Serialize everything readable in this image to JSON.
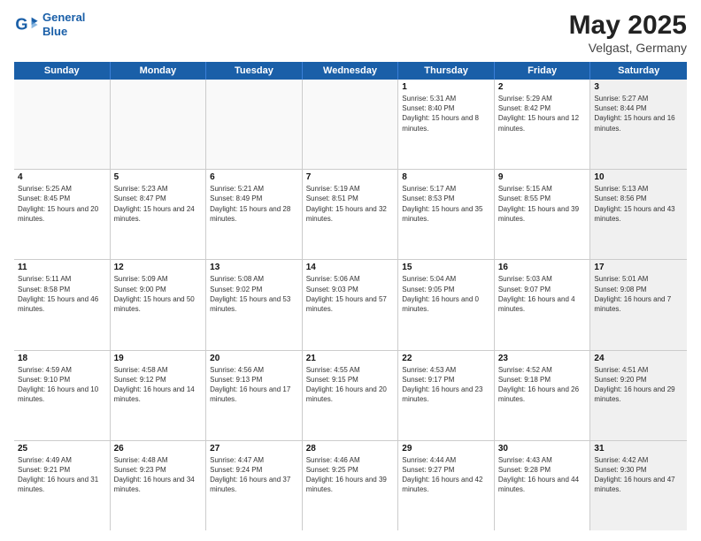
{
  "header": {
    "logo_line1": "General",
    "logo_line2": "Blue",
    "title": "May 2025",
    "subtitle": "Velgast, Germany"
  },
  "days_of_week": [
    "Sunday",
    "Monday",
    "Tuesday",
    "Wednesday",
    "Thursday",
    "Friday",
    "Saturday"
  ],
  "weeks": [
    [
      {
        "day": "",
        "sunrise": "",
        "sunset": "",
        "daylight": "",
        "shaded": false,
        "empty": true
      },
      {
        "day": "",
        "sunrise": "",
        "sunset": "",
        "daylight": "",
        "shaded": false,
        "empty": true
      },
      {
        "day": "",
        "sunrise": "",
        "sunset": "",
        "daylight": "",
        "shaded": false,
        "empty": true
      },
      {
        "day": "",
        "sunrise": "",
        "sunset": "",
        "daylight": "",
        "shaded": false,
        "empty": true
      },
      {
        "day": "1",
        "sunrise": "Sunrise: 5:31 AM",
        "sunset": "Sunset: 8:40 PM",
        "daylight": "Daylight: 15 hours and 8 minutes.",
        "shaded": false,
        "empty": false
      },
      {
        "day": "2",
        "sunrise": "Sunrise: 5:29 AM",
        "sunset": "Sunset: 8:42 PM",
        "daylight": "Daylight: 15 hours and 12 minutes.",
        "shaded": false,
        "empty": false
      },
      {
        "day": "3",
        "sunrise": "Sunrise: 5:27 AM",
        "sunset": "Sunset: 8:44 PM",
        "daylight": "Daylight: 15 hours and 16 minutes.",
        "shaded": true,
        "empty": false
      }
    ],
    [
      {
        "day": "4",
        "sunrise": "Sunrise: 5:25 AM",
        "sunset": "Sunset: 8:45 PM",
        "daylight": "Daylight: 15 hours and 20 minutes.",
        "shaded": false,
        "empty": false
      },
      {
        "day": "5",
        "sunrise": "Sunrise: 5:23 AM",
        "sunset": "Sunset: 8:47 PM",
        "daylight": "Daylight: 15 hours and 24 minutes.",
        "shaded": false,
        "empty": false
      },
      {
        "day": "6",
        "sunrise": "Sunrise: 5:21 AM",
        "sunset": "Sunset: 8:49 PM",
        "daylight": "Daylight: 15 hours and 28 minutes.",
        "shaded": false,
        "empty": false
      },
      {
        "day": "7",
        "sunrise": "Sunrise: 5:19 AM",
        "sunset": "Sunset: 8:51 PM",
        "daylight": "Daylight: 15 hours and 32 minutes.",
        "shaded": false,
        "empty": false
      },
      {
        "day": "8",
        "sunrise": "Sunrise: 5:17 AM",
        "sunset": "Sunset: 8:53 PM",
        "daylight": "Daylight: 15 hours and 35 minutes.",
        "shaded": false,
        "empty": false
      },
      {
        "day": "9",
        "sunrise": "Sunrise: 5:15 AM",
        "sunset": "Sunset: 8:55 PM",
        "daylight": "Daylight: 15 hours and 39 minutes.",
        "shaded": false,
        "empty": false
      },
      {
        "day": "10",
        "sunrise": "Sunrise: 5:13 AM",
        "sunset": "Sunset: 8:56 PM",
        "daylight": "Daylight: 15 hours and 43 minutes.",
        "shaded": true,
        "empty": false
      }
    ],
    [
      {
        "day": "11",
        "sunrise": "Sunrise: 5:11 AM",
        "sunset": "Sunset: 8:58 PM",
        "daylight": "Daylight: 15 hours and 46 minutes.",
        "shaded": false,
        "empty": false
      },
      {
        "day": "12",
        "sunrise": "Sunrise: 5:09 AM",
        "sunset": "Sunset: 9:00 PM",
        "daylight": "Daylight: 15 hours and 50 minutes.",
        "shaded": false,
        "empty": false
      },
      {
        "day": "13",
        "sunrise": "Sunrise: 5:08 AM",
        "sunset": "Sunset: 9:02 PM",
        "daylight": "Daylight: 15 hours and 53 minutes.",
        "shaded": false,
        "empty": false
      },
      {
        "day": "14",
        "sunrise": "Sunrise: 5:06 AM",
        "sunset": "Sunset: 9:03 PM",
        "daylight": "Daylight: 15 hours and 57 minutes.",
        "shaded": false,
        "empty": false
      },
      {
        "day": "15",
        "sunrise": "Sunrise: 5:04 AM",
        "sunset": "Sunset: 9:05 PM",
        "daylight": "Daylight: 16 hours and 0 minutes.",
        "shaded": false,
        "empty": false
      },
      {
        "day": "16",
        "sunrise": "Sunrise: 5:03 AM",
        "sunset": "Sunset: 9:07 PM",
        "daylight": "Daylight: 16 hours and 4 minutes.",
        "shaded": false,
        "empty": false
      },
      {
        "day": "17",
        "sunrise": "Sunrise: 5:01 AM",
        "sunset": "Sunset: 9:08 PM",
        "daylight": "Daylight: 16 hours and 7 minutes.",
        "shaded": true,
        "empty": false
      }
    ],
    [
      {
        "day": "18",
        "sunrise": "Sunrise: 4:59 AM",
        "sunset": "Sunset: 9:10 PM",
        "daylight": "Daylight: 16 hours and 10 minutes.",
        "shaded": false,
        "empty": false
      },
      {
        "day": "19",
        "sunrise": "Sunrise: 4:58 AM",
        "sunset": "Sunset: 9:12 PM",
        "daylight": "Daylight: 16 hours and 14 minutes.",
        "shaded": false,
        "empty": false
      },
      {
        "day": "20",
        "sunrise": "Sunrise: 4:56 AM",
        "sunset": "Sunset: 9:13 PM",
        "daylight": "Daylight: 16 hours and 17 minutes.",
        "shaded": false,
        "empty": false
      },
      {
        "day": "21",
        "sunrise": "Sunrise: 4:55 AM",
        "sunset": "Sunset: 9:15 PM",
        "daylight": "Daylight: 16 hours and 20 minutes.",
        "shaded": false,
        "empty": false
      },
      {
        "day": "22",
        "sunrise": "Sunrise: 4:53 AM",
        "sunset": "Sunset: 9:17 PM",
        "daylight": "Daylight: 16 hours and 23 minutes.",
        "shaded": false,
        "empty": false
      },
      {
        "day": "23",
        "sunrise": "Sunrise: 4:52 AM",
        "sunset": "Sunset: 9:18 PM",
        "daylight": "Daylight: 16 hours and 26 minutes.",
        "shaded": false,
        "empty": false
      },
      {
        "day": "24",
        "sunrise": "Sunrise: 4:51 AM",
        "sunset": "Sunset: 9:20 PM",
        "daylight": "Daylight: 16 hours and 29 minutes.",
        "shaded": true,
        "empty": false
      }
    ],
    [
      {
        "day": "25",
        "sunrise": "Sunrise: 4:49 AM",
        "sunset": "Sunset: 9:21 PM",
        "daylight": "Daylight: 16 hours and 31 minutes.",
        "shaded": false,
        "empty": false
      },
      {
        "day": "26",
        "sunrise": "Sunrise: 4:48 AM",
        "sunset": "Sunset: 9:23 PM",
        "daylight": "Daylight: 16 hours and 34 minutes.",
        "shaded": false,
        "empty": false
      },
      {
        "day": "27",
        "sunrise": "Sunrise: 4:47 AM",
        "sunset": "Sunset: 9:24 PM",
        "daylight": "Daylight: 16 hours and 37 minutes.",
        "shaded": false,
        "empty": false
      },
      {
        "day": "28",
        "sunrise": "Sunrise: 4:46 AM",
        "sunset": "Sunset: 9:25 PM",
        "daylight": "Daylight: 16 hours and 39 minutes.",
        "shaded": false,
        "empty": false
      },
      {
        "day": "29",
        "sunrise": "Sunrise: 4:44 AM",
        "sunset": "Sunset: 9:27 PM",
        "daylight": "Daylight: 16 hours and 42 minutes.",
        "shaded": false,
        "empty": false
      },
      {
        "day": "30",
        "sunrise": "Sunrise: 4:43 AM",
        "sunset": "Sunset: 9:28 PM",
        "daylight": "Daylight: 16 hours and 44 minutes.",
        "shaded": false,
        "empty": false
      },
      {
        "day": "31",
        "sunrise": "Sunrise: 4:42 AM",
        "sunset": "Sunset: 9:30 PM",
        "daylight": "Daylight: 16 hours and 47 minutes.",
        "shaded": true,
        "empty": false
      }
    ]
  ]
}
